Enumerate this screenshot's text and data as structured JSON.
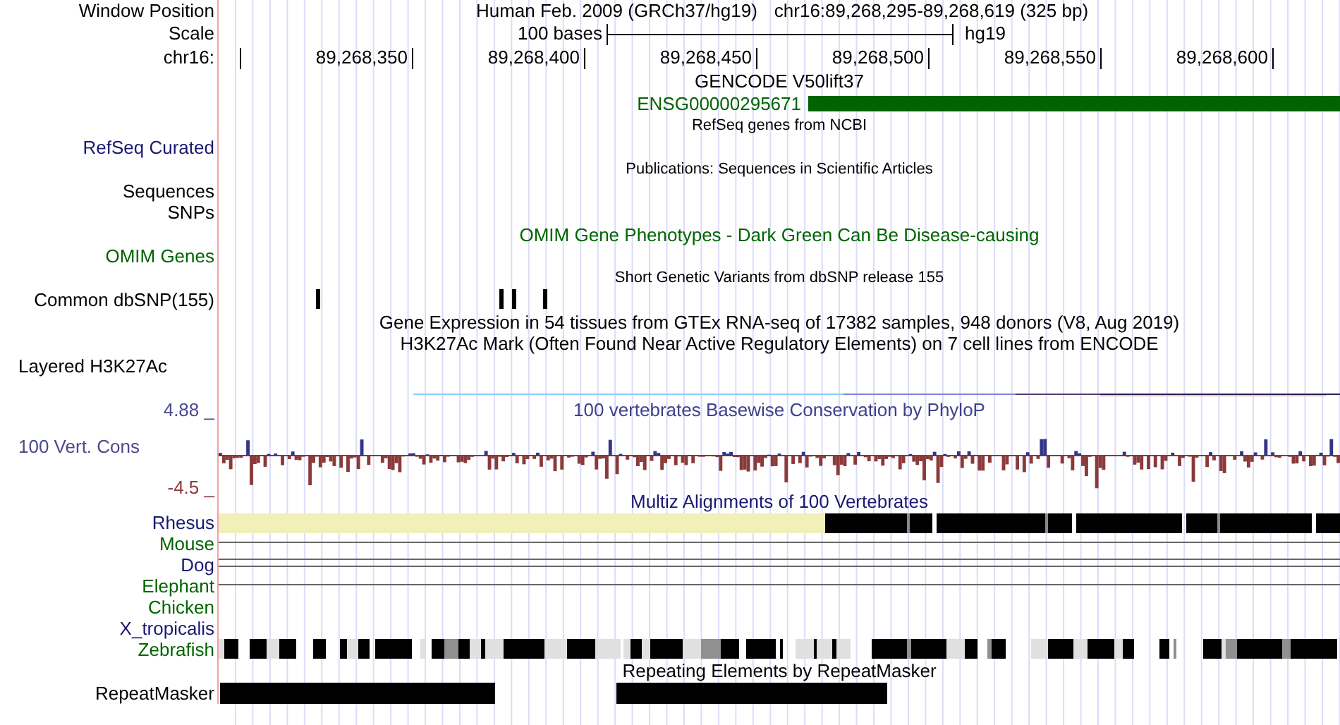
{
  "header": {
    "label": "Window Position",
    "assembly": "Human Feb. 2009 (GRCh37/hg19)",
    "region": "chr16:89,268,295-89,268,619 (325 bp)"
  },
  "scale": {
    "label": "Scale",
    "bases": "100 bases",
    "assembly": "hg19"
  },
  "ruler": {
    "label": "chr16:",
    "ticks": [
      "89,268,350",
      "89,268,400",
      "89,268,450",
      "89,268,500",
      "89,268,550",
      "89,268,600"
    ]
  },
  "tracks": [
    {
      "kind": "title",
      "text": "GENCODE V50lift37",
      "color": "#000000"
    },
    {
      "kind": "gene",
      "gene": "ENSG00000295671",
      "color": "#006400"
    },
    {
      "kind": "note",
      "text": "RefSeq genes from NCBI"
    },
    {
      "kind": "label",
      "label": "RefSeq Curated",
      "color": "#191970"
    },
    {
      "kind": "note",
      "text": "Publications: Sequences in Scientific Articles"
    },
    {
      "kind": "label",
      "label": "Sequences",
      "color": "#000000"
    },
    {
      "kind": "label",
      "label": "SNPs",
      "color": "#000000"
    },
    {
      "kind": "title",
      "text": "OMIM Gene Phenotypes - Dark Green Can Be Disease-causing",
      "color": "#006400"
    },
    {
      "kind": "label",
      "label": "OMIM Genes",
      "color": "#006400"
    },
    {
      "kind": "note",
      "text": "Short Genetic Variants from dbSNP release 155"
    },
    {
      "kind": "snp",
      "label": "Common dbSNP(155)",
      "color": "#000000"
    },
    {
      "kind": "title",
      "text": "Gene Expression in 54 tissues from GTEx RNA-seq of 17382 samples, 948 donors (V8, Aug 2019)",
      "color": "#000000"
    },
    {
      "kind": "title",
      "text": "H3K27Ac Mark (Often Found Near Active Regulatory Elements) on 7 cell lines from ENCODE",
      "color": "#000000"
    },
    {
      "kind": "label_left",
      "label": "Layered H3K27Ac",
      "color": "#000000"
    },
    {
      "kind": "signal_line"
    },
    {
      "kind": "phylop_title",
      "label": "4.88 _",
      "text": "100 vertebrates Basewise Conservation by PhyloP"
    },
    {
      "kind": "wiggle",
      "label": "100 Vert. Cons",
      "min_label": "-4.5 _"
    },
    {
      "kind": "title",
      "text": "Multiz Alignments of 100 Vertebrates",
      "color": "#191970"
    },
    {
      "kind": "align_blocks",
      "label": "Rhesus",
      "color": "#191970"
    },
    {
      "kind": "align_line",
      "label": "Mouse",
      "color": "#006400"
    },
    {
      "kind": "align_double_line",
      "label": "Dog",
      "color": "#191970"
    },
    {
      "kind": "align_line",
      "label": "Elephant",
      "color": "#006400"
    },
    {
      "kind": "align_empty",
      "label": "Chicken",
      "color": "#006400"
    },
    {
      "kind": "align_empty",
      "label": "X_tropicalis",
      "color": "#191970"
    },
    {
      "kind": "align_barcode",
      "label": "Zebrafish",
      "color": "#006400"
    },
    {
      "kind": "title",
      "text": "Repeating Elements by RepeatMasker",
      "color": "#000000"
    },
    {
      "kind": "repeat",
      "label": "RepeatMasker",
      "color": "#000000"
    }
  ]
}
